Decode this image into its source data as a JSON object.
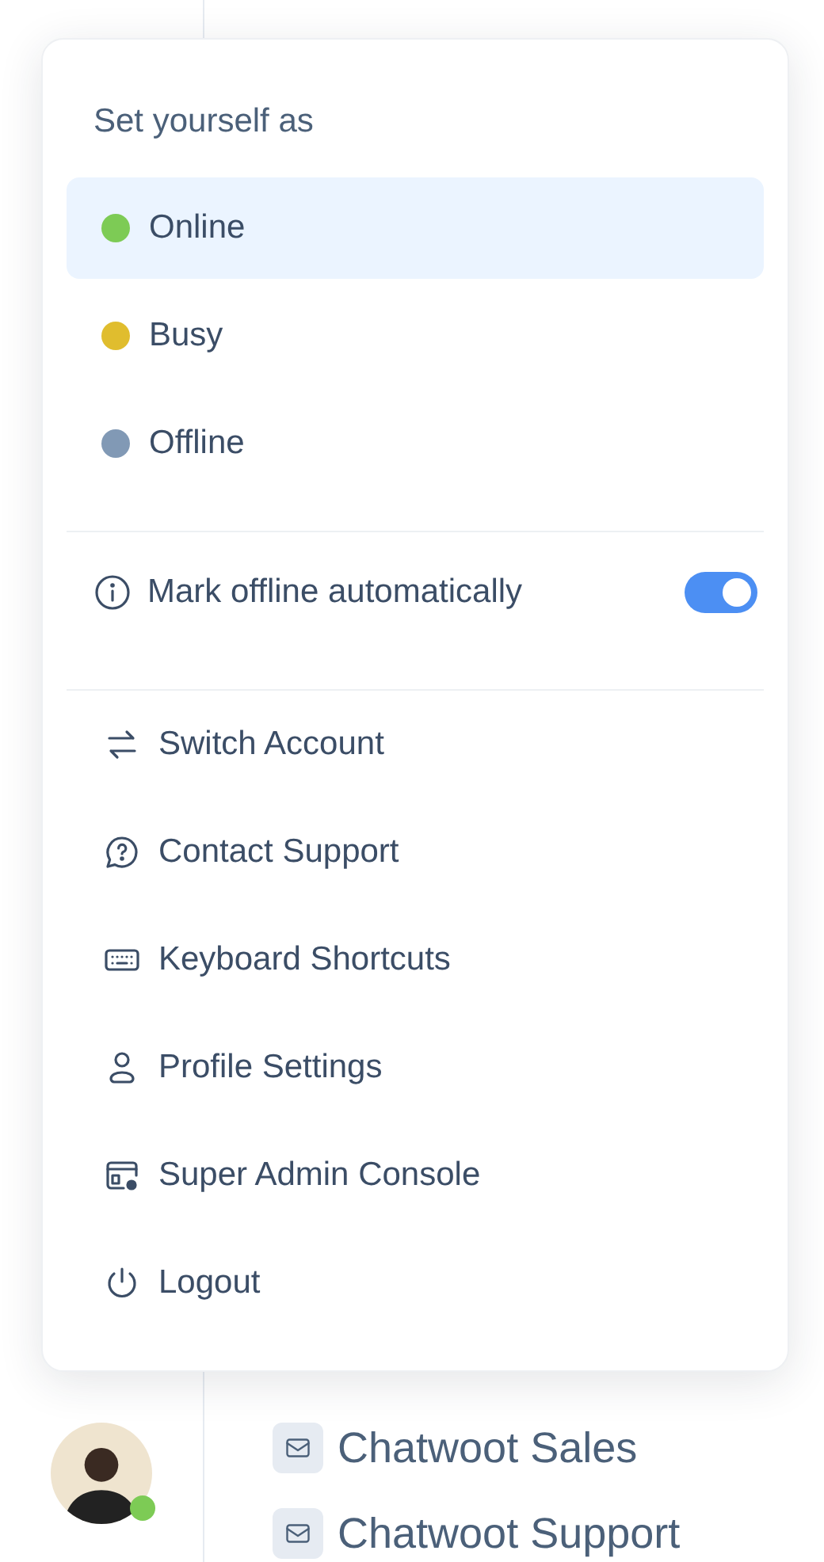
{
  "inboxes": [
    {
      "label": "Chatwoot Sales"
    },
    {
      "label": "Chatwoot Support"
    }
  ],
  "menu": {
    "title": "Set yourself as",
    "statuses": [
      {
        "label": "Online",
        "color": "#7dcb55",
        "selected": true
      },
      {
        "label": "Busy",
        "color": "#e0bd2e",
        "selected": false
      },
      {
        "label": "Offline",
        "color": "#8199b5",
        "selected": false
      }
    ],
    "auto_offline": {
      "label": "Mark offline automatically",
      "on": true
    },
    "actions": [
      {
        "label": "Switch Account",
        "kind": "switch"
      },
      {
        "label": "Contact Support",
        "kind": "support"
      },
      {
        "label": "Keyboard Shortcuts",
        "kind": "keyboard"
      },
      {
        "label": "Profile Settings",
        "kind": "profile"
      },
      {
        "label": "Super Admin Console",
        "kind": "admin"
      },
      {
        "label": "Logout",
        "kind": "logout"
      }
    ]
  }
}
